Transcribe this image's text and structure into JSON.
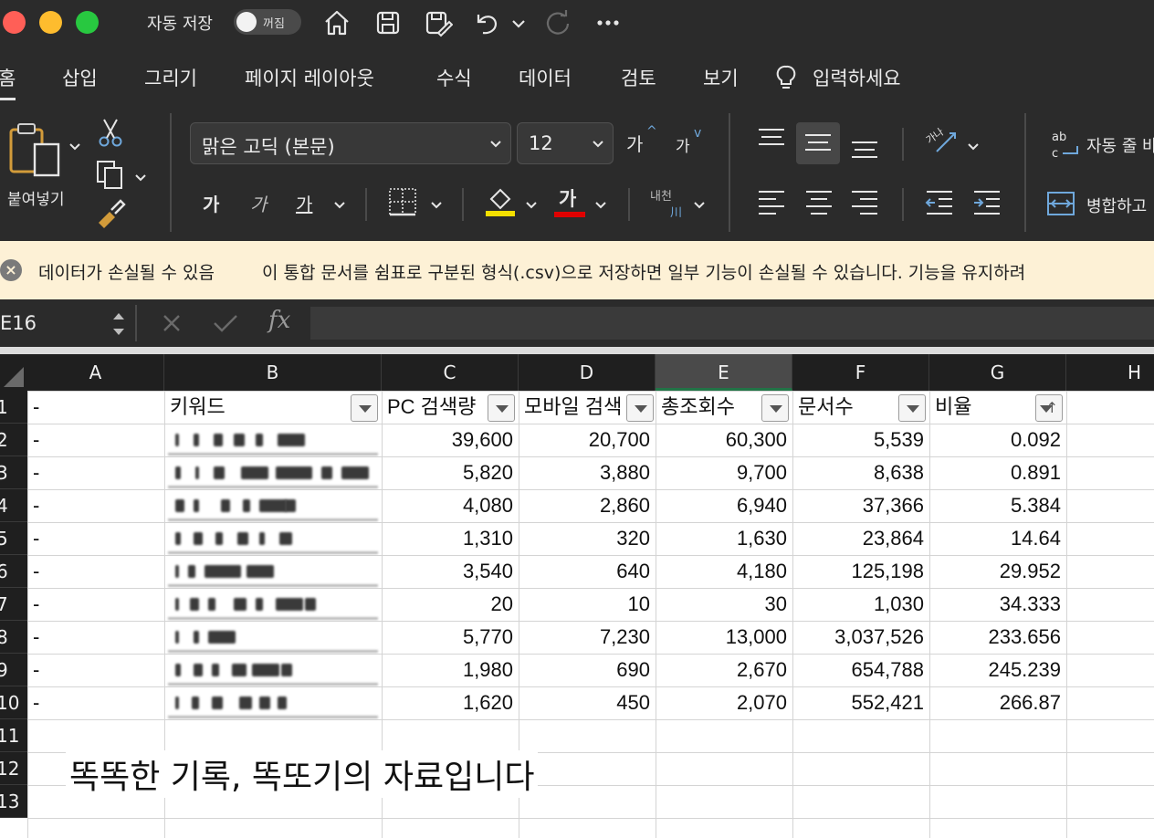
{
  "titlebar": {
    "autosave_label": "자동 저장",
    "autosave_toggle": "꺼짐",
    "icons": [
      "home-icon",
      "save-icon",
      "save-as-icon",
      "undo-icon",
      "redo-icon",
      "more-icon"
    ]
  },
  "tabs": [
    {
      "label": "홈",
      "active": true
    },
    {
      "label": "삽입"
    },
    {
      "label": "그리기"
    },
    {
      "label": "페이지 레이아웃"
    },
    {
      "label": "수식"
    },
    {
      "label": "데이터"
    },
    {
      "label": "검토"
    },
    {
      "label": "보기"
    },
    {
      "label": "입력하세요"
    }
  ],
  "ribbon": {
    "paste_label": "붙여넣기",
    "font_name": "맑은 고딕 (본문)",
    "font_size": "12",
    "grow_font": "가",
    "shrink_font": "가",
    "bold": "가",
    "italic": "가",
    "underline": "가",
    "font_color_glyph": "가",
    "phonetic": "내천",
    "wrap_text": "자동 줄 바꿈",
    "merge": "병합하고",
    "fill_color": "#f5e000",
    "font_color": "#e00000"
  },
  "warning": {
    "title": "데이터가 손실될 수 있음",
    "message": "이 통합 문서를 쉼표로 구분된 형식(.csv)으로 저장하면 일부 기능이 손실될 수 있습니다. 기능을 유지하려"
  },
  "formula_bar": {
    "name_box": "E16",
    "formula": ""
  },
  "sheet": {
    "columns": [
      "A",
      "B",
      "C",
      "D",
      "E",
      "F",
      "G",
      "H"
    ],
    "selected_column": "E",
    "row_numbers": [
      "1",
      "2",
      "3",
      "4",
      "5",
      "6",
      "7",
      "8",
      "9",
      "10",
      "11",
      "12",
      "13"
    ],
    "headers": {
      "a": "-",
      "b": "키워드",
      "c": "PC 검색량",
      "d": "모바일 검색",
      "e": "총조회수",
      "f": "문서수",
      "g": "비율"
    },
    "rows": [
      {
        "a": "-",
        "c": "39,600",
        "d": "20,700",
        "e": "60,300",
        "f": "5,539",
        "g": "0.092"
      },
      {
        "a": "-",
        "c": "5,820",
        "d": "3,880",
        "e": "9,700",
        "f": "8,638",
        "g": "0.891"
      },
      {
        "a": "-",
        "c": "4,080",
        "d": "2,860",
        "e": "6,940",
        "f": "37,366",
        "g": "5.384"
      },
      {
        "a": "-",
        "c": "1,310",
        "d": "320",
        "e": "1,630",
        "f": "23,864",
        "g": "14.64"
      },
      {
        "a": "-",
        "c": "3,540",
        "d": "640",
        "e": "4,180",
        "f": "125,198",
        "g": "29.952"
      },
      {
        "a": "-",
        "c": "20",
        "d": "10",
        "e": "30",
        "f": "1,030",
        "g": "34.333"
      },
      {
        "a": "-",
        "c": "5,770",
        "d": "7,230",
        "e": "13,000",
        "f": "3,037,526",
        "g": "233.656"
      },
      {
        "a": "-",
        "c": "1,980",
        "d": "690",
        "e": "2,670",
        "f": "654,788",
        "g": "245.239"
      },
      {
        "a": "-",
        "c": "1,620",
        "d": "450",
        "e": "2,070",
        "f": "552,421",
        "g": "266.87"
      }
    ],
    "watermark": "똑똑한 기록, 똑또기의 자료입니다"
  }
}
